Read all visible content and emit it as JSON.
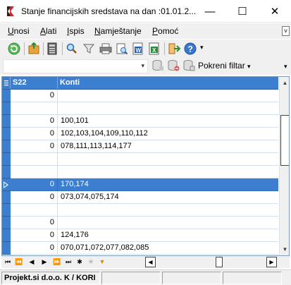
{
  "window": {
    "title": "Stanje financijskih sredstava na dan :01.01.2...",
    "minimize_glyph": "—",
    "maximize_glyph": "☐",
    "close_glyph": "✕"
  },
  "menu": {
    "items": [
      {
        "label": "Unosi",
        "underline": "U",
        "rest": "nosi"
      },
      {
        "label": "Alati",
        "underline": "A",
        "rest": "lati"
      },
      {
        "label": "Ispis",
        "underline": "I",
        "rest": "spis"
      },
      {
        "label": "Namještanje",
        "underline": "N",
        "rest": "amještanje"
      },
      {
        "label": "Pomoć",
        "underline": "P",
        "rest": "omoć"
      }
    ],
    "overflow_glyph": "˅"
  },
  "toolbar": {
    "icons": [
      "refresh-icon",
      "export-icon",
      "calculator-icon",
      "search-icon",
      "filter-icon",
      "print-icon",
      "print-preview-icon",
      "export-word-icon",
      "export-excel-icon",
      "exit-icon",
      "help-icon"
    ],
    "overflow_glyph": "▾"
  },
  "filterbar": {
    "combo_value": "",
    "filter_button_label": "Pokreni filtar",
    "filter_arrow": "▾",
    "overflow_glyph": "▾"
  },
  "grid": {
    "columns": [
      "S22",
      "Konti"
    ],
    "rows": [
      {
        "s22": "0",
        "konti": ""
      },
      {
        "s22": "",
        "konti": ""
      },
      {
        "s22": "0",
        "konti": "100,101"
      },
      {
        "s22": "0",
        "konti": "102,103,104,109,110,112"
      },
      {
        "s22": "0",
        "konti": "078,111,113,114,177"
      },
      {
        "s22": "",
        "konti": ""
      },
      {
        "s22": "",
        "konti": ""
      },
      {
        "s22": "0",
        "konti": "170,174",
        "selected": true
      },
      {
        "s22": "0",
        "konti": "073,074,075,174"
      },
      {
        "s22": "",
        "konti": ""
      },
      {
        "s22": "0",
        "konti": ""
      },
      {
        "s22": "0",
        "konti": "124,176"
      },
      {
        "s22": "0",
        "konti": "070,071,072,077,082,085"
      }
    ]
  },
  "navigator": {
    "buttons": [
      "⏮",
      "⏪",
      "◀",
      "▶",
      "⏩",
      "⏭",
      "✱",
      "✳",
      "▼"
    ]
  },
  "status": {
    "company": "Projekt.si d.o.o. K / KORI"
  },
  "colors": {
    "header_blue": "#3c7fd1",
    "selection_blue": "#3c7fd1"
  }
}
